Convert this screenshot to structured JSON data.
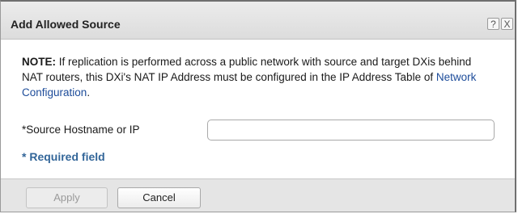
{
  "dialog": {
    "title": "Add Allowed Source",
    "help_glyph": "?",
    "close_glyph": "X"
  },
  "note": {
    "prefix": "NOTE:",
    "text": " If replication is performed across a public network with source and target DXis behind NAT routers, this DXi's NAT IP Address must be configured in the IP Address Table of ",
    "link_text": "Network Configuration",
    "suffix": "."
  },
  "form": {
    "hostname_label": "*Source Hostname or IP",
    "hostname_value": "",
    "required_text": "* Required field"
  },
  "footer": {
    "apply_label": "Apply",
    "cancel_label": "Cancel"
  },
  "colors": {
    "link": "#1d4c9a",
    "required": "#336699"
  }
}
